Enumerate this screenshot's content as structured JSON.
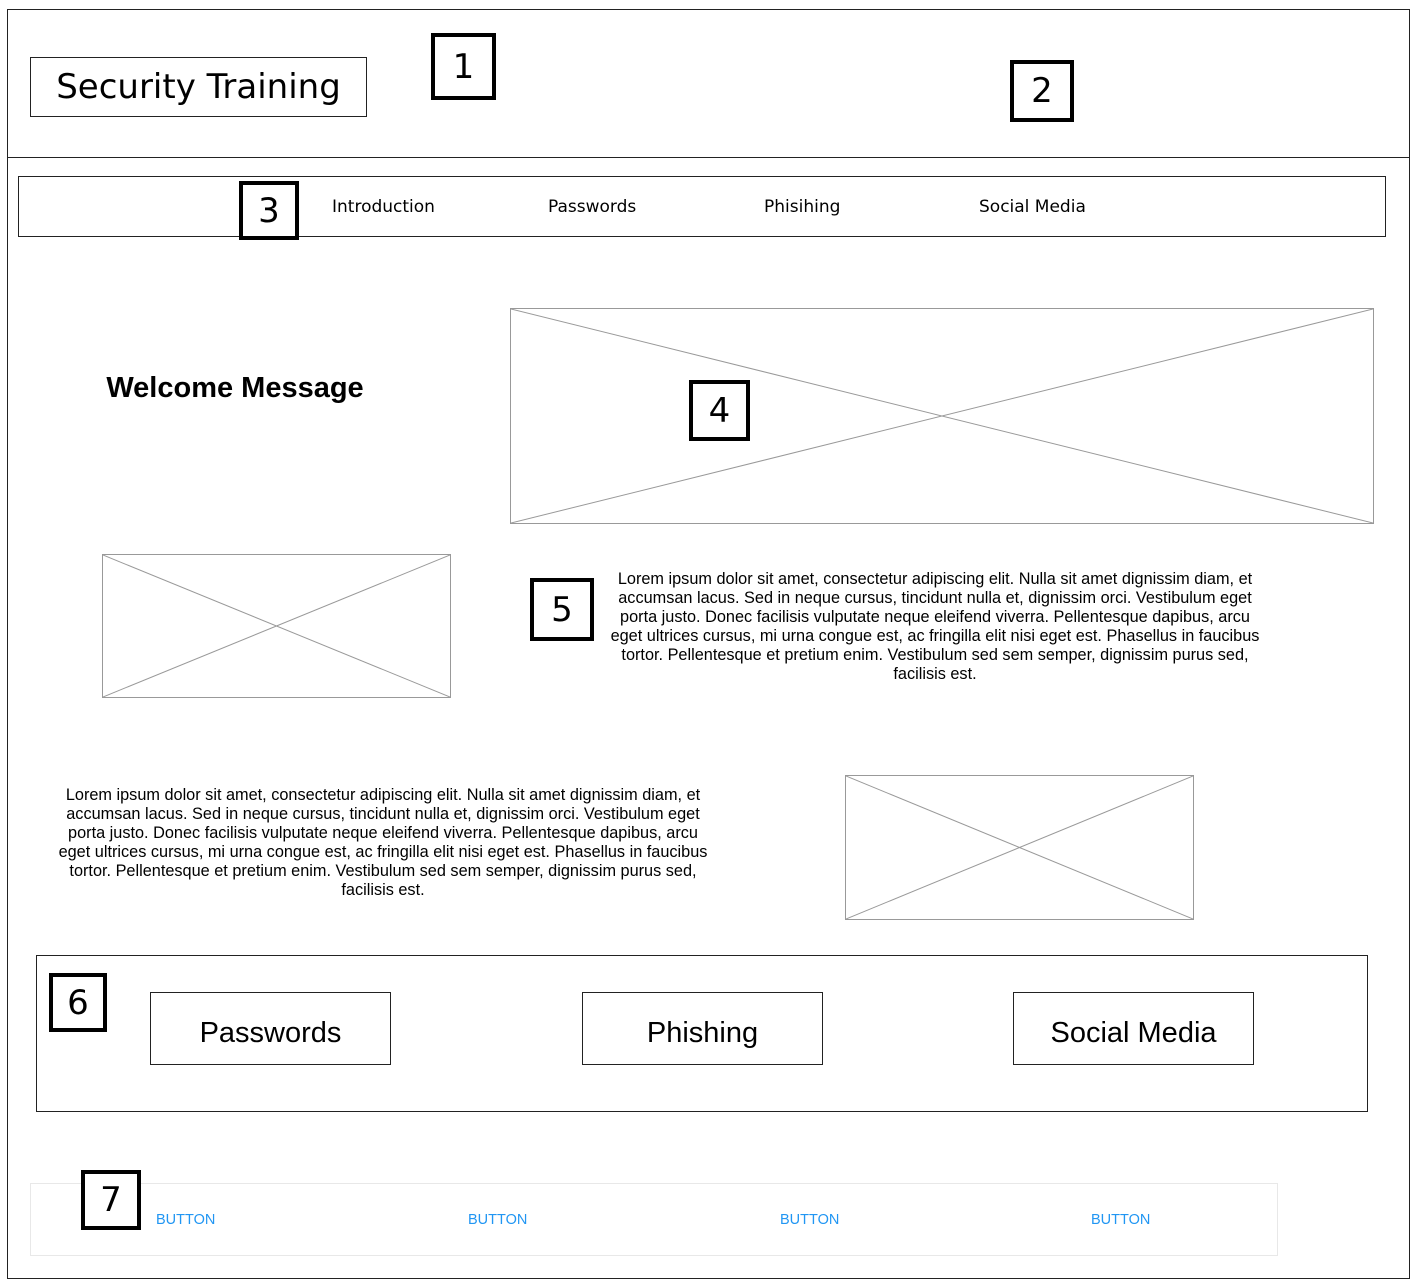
{
  "header": {
    "title": "Security Training"
  },
  "nav": {
    "items": [
      "Introduction",
      "Passwords",
      "Phisihing",
      "Social Media"
    ]
  },
  "main": {
    "welcome": "Welcome Message",
    "paragraph_1": "Lorem ipsum dolor sit amet, consectetur adipiscing elit. Nulla sit amet dignissim diam, et accumsan lacus. Sed in neque cursus, tincidunt nulla et, dignissim orci. Vestibulum eget porta justo. Donec facilisis vulputate neque eleifend viverra. Pellentesque dapibus, arcu eget ultrices cursus, mi urna congue est, ac fringilla elit nisi eget est. Phasellus in faucibus tortor. Pellentesque et pretium enim. Vestibulum sed sem semper, dignissim purus sed, facilisis est.",
    "paragraph_2": "Lorem ipsum dolor sit amet, consectetur adipiscing elit. Nulla sit amet dignissim diam, et accumsan lacus. Sed in neque cursus, tincidunt nulla et, dignissim orci. Vestibulum eget porta justo. Donec facilisis vulputate neque eleifend viverra. Pellentesque dapibus, arcu eget ultrices cursus, mi urna congue est, ac fringilla elit nisi eget est. Phasellus in faucibus tortor. Pellentesque et pretium enim. Vestibulum sed sem semper, dignissim purus sed, facilisis est."
  },
  "cards": [
    "Passwords",
    "Phishing",
    "Social Media"
  ],
  "footer": {
    "buttons": [
      "BUTTON",
      "BUTTON",
      "BUTTON",
      "BUTTON"
    ],
    "button_color": "#2196f3"
  },
  "annotations": [
    "1",
    "2",
    "3",
    "4",
    "5",
    "6",
    "7"
  ]
}
